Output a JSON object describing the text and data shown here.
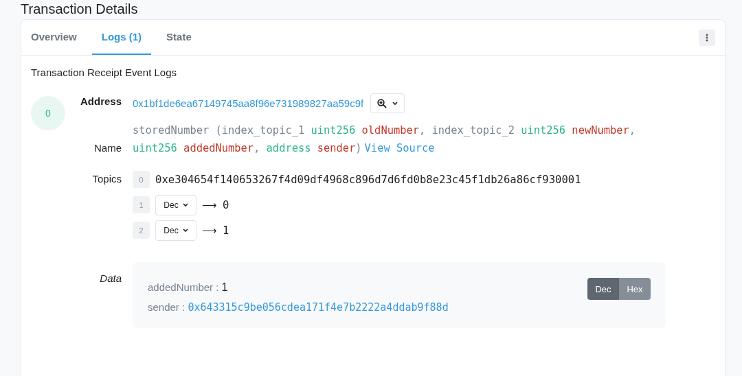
{
  "page_title": "Transaction Details",
  "tabs": [
    {
      "label": "Overview",
      "selected": false
    },
    {
      "label": "Logs (1)",
      "selected": true
    },
    {
      "label": "State",
      "selected": false
    }
  ],
  "section_title": "Transaction Receipt Event Logs",
  "logs": [
    {
      "index": "0",
      "address_label": "Address",
      "address": "0x1bf1de6ea67149745aa8f96e731989827aa59c9f",
      "name_label": "Name",
      "signature": [
        {
          "kind": "text",
          "text": "storedNumber ("
        },
        {
          "kind": "text",
          "text": "index_topic_1 "
        },
        {
          "kind": "type",
          "text": "uint256"
        },
        {
          "kind": "param",
          "text": "oldNumber"
        },
        {
          "kind": "text",
          "text": ", index_topic_2 "
        },
        {
          "kind": "type",
          "text": "uint256"
        },
        {
          "kind": "param",
          "text": "newNumber"
        },
        {
          "kind": "text",
          "text": ", "
        },
        {
          "kind": "type",
          "text": "uint256"
        },
        {
          "kind": "param",
          "text": "addedNumber"
        },
        {
          "kind": "text",
          "text": ", "
        },
        {
          "kind": "type",
          "text": "address"
        },
        {
          "kind": "param",
          "text": "sender"
        },
        {
          "kind": "text",
          "text": ")"
        }
      ],
      "view_source": "View Source",
      "topics_label": "Topics",
      "topics": [
        {
          "index": "0",
          "kind": "raw",
          "value": "0xe304654f140653267f4d09df4968c896d7d6fd0b8e23c45f1db26a86cf930001"
        },
        {
          "index": "1",
          "kind": "decoded",
          "format": "Dec",
          "arrow": "⟶",
          "value": "0"
        },
        {
          "index": "2",
          "kind": "decoded",
          "format": "Dec",
          "arrow": "⟶",
          "value": "1"
        }
      ],
      "data_label": "Data",
      "data": [
        {
          "name": "addedNumber :",
          "kind": "plain",
          "value": "1"
        },
        {
          "name": "sender :",
          "kind": "link",
          "value": "0x643315c9be056cdea171f4e7b2222a4ddab9f88d"
        }
      ],
      "format_toggle": [
        {
          "label": "Dec",
          "selected": true
        },
        {
          "label": "Hex",
          "selected": false
        }
      ]
    }
  ]
}
